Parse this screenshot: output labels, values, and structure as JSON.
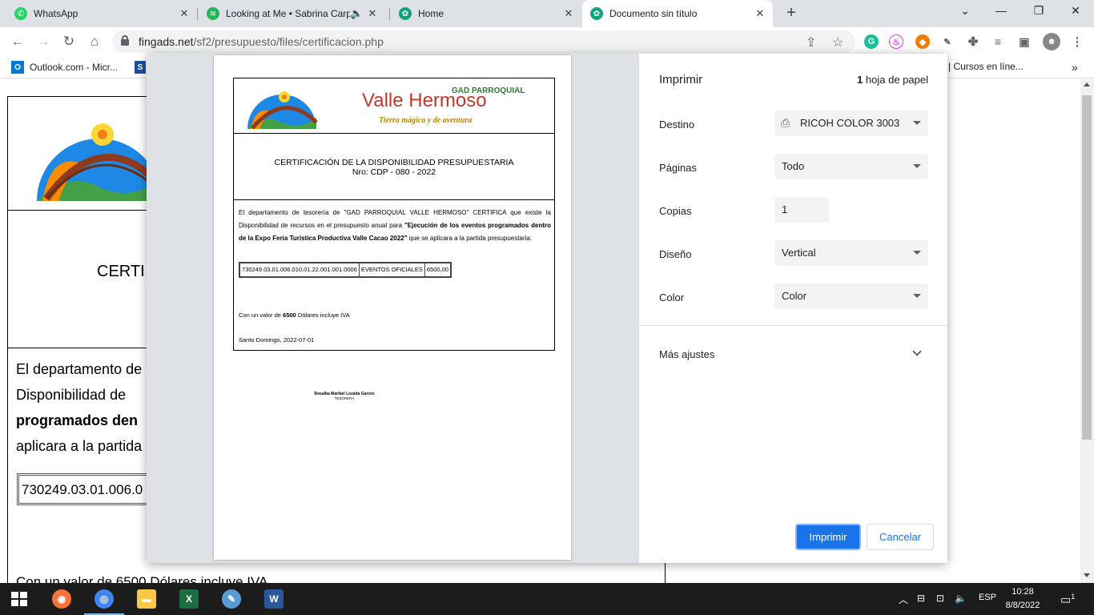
{
  "tabs": [
    {
      "title": "WhatsApp",
      "icon": "whatsapp-icon",
      "color": "#25d366"
    },
    {
      "title": "Looking at Me • Sabrina Carp",
      "icon": "spotify-icon",
      "color": "#1db954"
    },
    {
      "title": "Home",
      "icon": "chatgpt-icon",
      "color": "#10a37f"
    },
    {
      "title": "Documento sin título",
      "icon": "chatgpt-icon",
      "color": "#10a37f"
    }
  ],
  "address": {
    "domain": "fingads.net",
    "path": "/sf2/presupuesto/files/certificacion.php"
  },
  "bookmarks": [
    {
      "label": "Outlook.com - Micr...",
      "icon": "outlook-icon"
    },
    {
      "label": "| Cursos en líne...",
      "icon": ""
    }
  ],
  "background_doc": {
    "cert_partial": "CERTI",
    "line1": "El departamento de",
    "line2": "Disponibilidad de",
    "line3": "programados den",
    "line4": "aplicara a la partida",
    "partida_partial": "730249.03.01.006.0",
    "valor_partial": "Con un valor de 6500 Dólares incluye IVA"
  },
  "print_dialog": {
    "title": "Imprimir",
    "sheets_count": "1",
    "sheets_label": "hoja de papel",
    "destino_label": "Destino",
    "destino_value": "RICOH COLOR 3003",
    "paginas_label": "Páginas",
    "paginas_value": "Todo",
    "copias_label": "Copias",
    "copias_value": "1",
    "diseno_label": "Diseño",
    "diseno_value": "Vertical",
    "color_label": "Color",
    "color_value": "Color",
    "mas_ajustes": "Más ajustes",
    "print_button": "Imprimir",
    "cancel_button": "Cancelar"
  },
  "preview_doc": {
    "logo_title": "Valle Hermoso",
    "logo_gad": "GAD PARROQUIAL",
    "logo_tagline": "Tierra mágica y de aventura",
    "cert_title": "CERTIFICACIÓN DE LA DISPONIBILIDAD PRESUPUESTARIA",
    "cert_number": "Nro: CDP - 080 - 2022",
    "body_intro": "El departamento de tesorería de \"GAD PARROQUIAL VALLE HERMOSO\" CERTIFICA que existe la Disponibilidad de recursos en el presupuesto anual para ",
    "body_bold": "\"Ejecución de los eventos programados dentro de la Expo Feria Turística Productiva Valle Cacao 2022\"",
    "body_end": " que se aplicara a la partida presupuestaria:",
    "partida_code": "730249.03.01.006.010.01.22.001.001.0006",
    "partida_name": "EVENTOS OFICIALES",
    "partida_amount": "6500,00",
    "valor_prefix": "Con un valor de ",
    "valor_amount": "6500",
    "valor_suffix": " Dólares incluye IVA",
    "fecha": "Santo Domingo, 2022-07-01",
    "signer_name": "Rosalba Maribel Lozada Garcés",
    "signer_role": "TESORERA"
  },
  "taskbar": {
    "lang": "ESP",
    "time": "10:28",
    "date": "8/8/2022",
    "notifications": "1"
  }
}
